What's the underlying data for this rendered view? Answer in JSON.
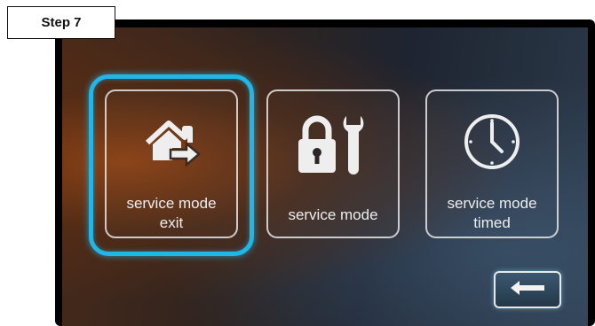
{
  "step_label": "Step 7",
  "tiles": [
    {
      "label": "service mode\nexit",
      "icon": "home-exit-icon",
      "selected": true
    },
    {
      "label": "service mode",
      "icon": "lock-wrench-icon",
      "selected": false
    },
    {
      "label": "service mode\ntimed",
      "icon": "clock-icon",
      "selected": false
    }
  ],
  "back_button": {
    "icon": "back-arrow-icon"
  },
  "colors": {
    "highlight": "#1fb6ea",
    "tile_border": "#e6e6e6"
  }
}
